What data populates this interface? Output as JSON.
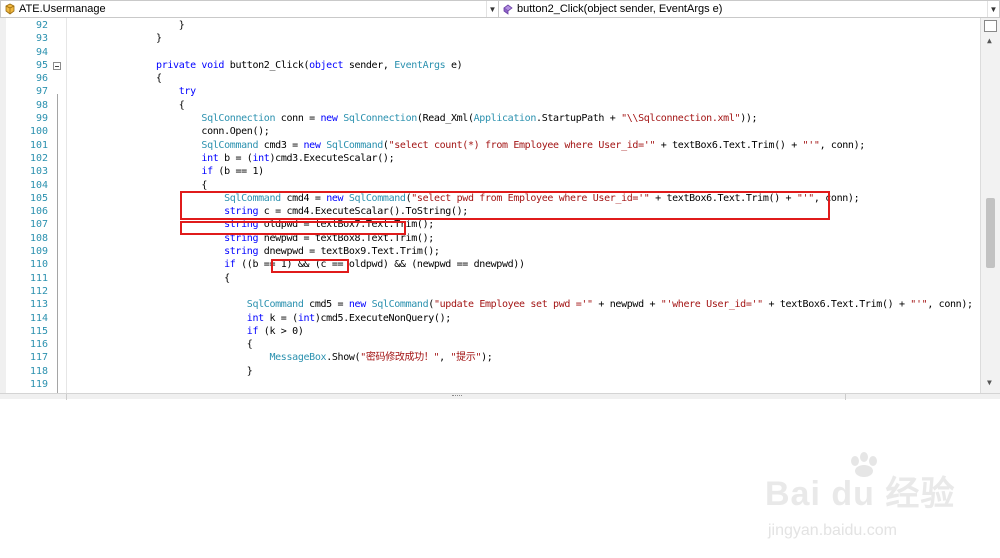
{
  "navbar": {
    "class_combo": "ATE.Usermanage",
    "member_combo": "button2_Click(object sender, EventArgs e)"
  },
  "lines": [
    {
      "n": "92",
      "tokens": [
        {
          "t": "                }",
          "c": ""
        }
      ]
    },
    {
      "n": "93",
      "tokens": [
        {
          "t": "            }",
          "c": ""
        }
      ]
    },
    {
      "n": "94",
      "tokens": []
    },
    {
      "n": "95",
      "tokens": [
        {
          "t": "            ",
          "c": ""
        },
        {
          "t": "private",
          "c": "kw"
        },
        {
          "t": " ",
          "c": ""
        },
        {
          "t": "void",
          "c": "kw"
        },
        {
          "t": " button2_Click(",
          "c": ""
        },
        {
          "t": "object",
          "c": "kw"
        },
        {
          "t": " sender, ",
          "c": ""
        },
        {
          "t": "EventArgs",
          "c": "ty"
        },
        {
          "t": " e)",
          "c": ""
        }
      ]
    },
    {
      "n": "96",
      "tokens": [
        {
          "t": "            {",
          "c": ""
        }
      ]
    },
    {
      "n": "97",
      "tokens": [
        {
          "t": "                ",
          "c": ""
        },
        {
          "t": "try",
          "c": "kw"
        }
      ]
    },
    {
      "n": "98",
      "tokens": [
        {
          "t": "                {",
          "c": ""
        }
      ]
    },
    {
      "n": "99",
      "tokens": [
        {
          "t": "                    ",
          "c": ""
        },
        {
          "t": "SqlConnection",
          "c": "ty"
        },
        {
          "t": " conn = ",
          "c": ""
        },
        {
          "t": "new",
          "c": "kw"
        },
        {
          "t": " ",
          "c": ""
        },
        {
          "t": "SqlConnection",
          "c": "ty"
        },
        {
          "t": "(Read_Xml(",
          "c": ""
        },
        {
          "t": "Application",
          "c": "ty"
        },
        {
          "t": ".StartupPath + ",
          "c": ""
        },
        {
          "t": "\"\\\\Sqlconnection.xml\"",
          "c": "st"
        },
        {
          "t": "));",
          "c": ""
        }
      ]
    },
    {
      "n": "100",
      "tokens": [
        {
          "t": "                    conn.Open();",
          "c": ""
        }
      ]
    },
    {
      "n": "101",
      "tokens": [
        {
          "t": "                    ",
          "c": ""
        },
        {
          "t": "SqlCommand",
          "c": "ty"
        },
        {
          "t": " cmd3 = ",
          "c": ""
        },
        {
          "t": "new",
          "c": "kw"
        },
        {
          "t": " ",
          "c": ""
        },
        {
          "t": "SqlCommand",
          "c": "ty"
        },
        {
          "t": "(",
          "c": ""
        },
        {
          "t": "\"select count(*) from Employee where User_id='\"",
          "c": "st"
        },
        {
          "t": " + textBox6.Text.Trim() + ",
          "c": ""
        },
        {
          "t": "\"'\"",
          "c": "st"
        },
        {
          "t": ", conn);",
          "c": ""
        }
      ]
    },
    {
      "n": "102",
      "tokens": [
        {
          "t": "                    ",
          "c": ""
        },
        {
          "t": "int",
          "c": "kw"
        },
        {
          "t": " b = (",
          "c": ""
        },
        {
          "t": "int",
          "c": "kw"
        },
        {
          "t": ")cmd3.ExecuteScalar();",
          "c": ""
        }
      ]
    },
    {
      "n": "103",
      "tokens": [
        {
          "t": "                    ",
          "c": ""
        },
        {
          "t": "if",
          "c": "kw"
        },
        {
          "t": " (b == 1)",
          "c": ""
        }
      ]
    },
    {
      "n": "104",
      "tokens": [
        {
          "t": "                    {",
          "c": ""
        }
      ]
    },
    {
      "n": "105",
      "tokens": [
        {
          "t": "                        ",
          "c": ""
        },
        {
          "t": "SqlCommand",
          "c": "ty"
        },
        {
          "t": " cmd4 = ",
          "c": ""
        },
        {
          "t": "new",
          "c": "kw"
        },
        {
          "t": " ",
          "c": ""
        },
        {
          "t": "SqlCommand",
          "c": "ty"
        },
        {
          "t": "(",
          "c": ""
        },
        {
          "t": "\"select pwd from Employee where User_id='\"",
          "c": "st"
        },
        {
          "t": " + textBox6.Text.Trim() + ",
          "c": ""
        },
        {
          "t": "\"'\"",
          "c": "st"
        },
        {
          "t": ", conn);",
          "c": ""
        }
      ]
    },
    {
      "n": "106",
      "tokens": [
        {
          "t": "                        ",
          "c": ""
        },
        {
          "t": "string",
          "c": "kw"
        },
        {
          "t": " c = cmd4.ExecuteScalar().ToString();",
          "c": ""
        }
      ]
    },
    {
      "n": "107",
      "tokens": [
        {
          "t": "                        ",
          "c": ""
        },
        {
          "t": "string",
          "c": "kw"
        },
        {
          "t": " oldpwd = textBox7.Text.Trim();",
          "c": ""
        }
      ]
    },
    {
      "n": "108",
      "tokens": [
        {
          "t": "                        ",
          "c": ""
        },
        {
          "t": "string",
          "c": "kw"
        },
        {
          "t": " newpwd = textBox8.Text.Trim();",
          "c": ""
        }
      ]
    },
    {
      "n": "109",
      "tokens": [
        {
          "t": "                        ",
          "c": ""
        },
        {
          "t": "string",
          "c": "kw"
        },
        {
          "t": " dnewpwd = textBox9.Text.Trim();",
          "c": ""
        }
      ]
    },
    {
      "n": "110",
      "tokens": [
        {
          "t": "                        ",
          "c": ""
        },
        {
          "t": "if",
          "c": "kw"
        },
        {
          "t": " ((b == 1) && (c == oldpwd) && (newpwd == dnewpwd))",
          "c": ""
        }
      ]
    },
    {
      "n": "111",
      "tokens": [
        {
          "t": "                        {",
          "c": ""
        }
      ]
    },
    {
      "n": "112",
      "tokens": []
    },
    {
      "n": "113",
      "tokens": [
        {
          "t": "                            ",
          "c": ""
        },
        {
          "t": "SqlCommand",
          "c": "ty"
        },
        {
          "t": " cmd5 = ",
          "c": ""
        },
        {
          "t": "new",
          "c": "kw"
        },
        {
          "t": " ",
          "c": ""
        },
        {
          "t": "SqlCommand",
          "c": "ty"
        },
        {
          "t": "(",
          "c": ""
        },
        {
          "t": "\"update Employee set pwd ='\"",
          "c": "st"
        },
        {
          "t": " + newpwd + ",
          "c": ""
        },
        {
          "t": "\"'where User_id='\"",
          "c": "st"
        },
        {
          "t": " + textBox6.Text.Trim() + ",
          "c": ""
        },
        {
          "t": "\"'\"",
          "c": "st"
        },
        {
          "t": ", conn);",
          "c": ""
        }
      ]
    },
    {
      "n": "114",
      "tokens": [
        {
          "t": "                            ",
          "c": ""
        },
        {
          "t": "int",
          "c": "kw"
        },
        {
          "t": " k = (",
          "c": ""
        },
        {
          "t": "int",
          "c": "kw"
        },
        {
          "t": ")cmd5.ExecuteNonQuery();",
          "c": ""
        }
      ]
    },
    {
      "n": "115",
      "tokens": [
        {
          "t": "                            ",
          "c": ""
        },
        {
          "t": "if",
          "c": "kw"
        },
        {
          "t": " (k > 0)",
          "c": ""
        }
      ]
    },
    {
      "n": "116",
      "tokens": [
        {
          "t": "                            {",
          "c": ""
        }
      ]
    },
    {
      "n": "117",
      "tokens": [
        {
          "t": "                                ",
          "c": ""
        },
        {
          "t": "MessageBox",
          "c": "ty"
        },
        {
          "t": ".Show(",
          "c": ""
        },
        {
          "t": "\"密码修改成功！\"",
          "c": "st"
        },
        {
          "t": ", ",
          "c": ""
        },
        {
          "t": "\"提示\"",
          "c": "st"
        },
        {
          "t": ");",
          "c": ""
        }
      ]
    },
    {
      "n": "118",
      "tokens": [
        {
          "t": "                            }",
          "c": ""
        }
      ]
    },
    {
      "n": "119",
      "tokens": []
    }
  ],
  "watermark": {
    "brand": "Bai du 经验",
    "url": "jingyan.baidu.com"
  }
}
